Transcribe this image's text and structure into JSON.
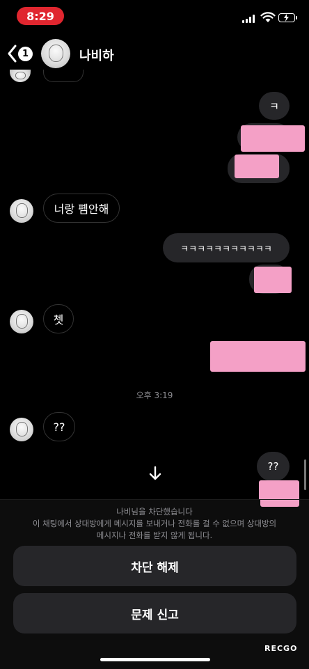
{
  "status_bar": {
    "time": "8:29"
  },
  "header": {
    "back_count": "1",
    "title": "나비하"
  },
  "messages": {
    "out_k": "ㅋ",
    "in_1": "너랑 폠안해",
    "out_kk": "ㅋㅋㅋㅋㅋㅋㅋㅋㅋㅋㅋ",
    "in_2": "쳇",
    "timestamp": "오후 3:19",
    "in_3": "??",
    "out_q": "??"
  },
  "blocked": {
    "title": "나비님을 차단했습니다",
    "line1": "이 채팅에서 상대방에게 메시지를 보내거나 전화를 걸 수 없으며 상대방의",
    "line2": "메시지나 전화를 받지 않게 됩니다."
  },
  "buttons": {
    "unblock": "차단 해제",
    "report": "문제 신고"
  },
  "watermark": "RECGO",
  "colors": {
    "status_pill": "#e0262f",
    "bubble_out": "#262629",
    "redaction": "#f4a0c6"
  }
}
